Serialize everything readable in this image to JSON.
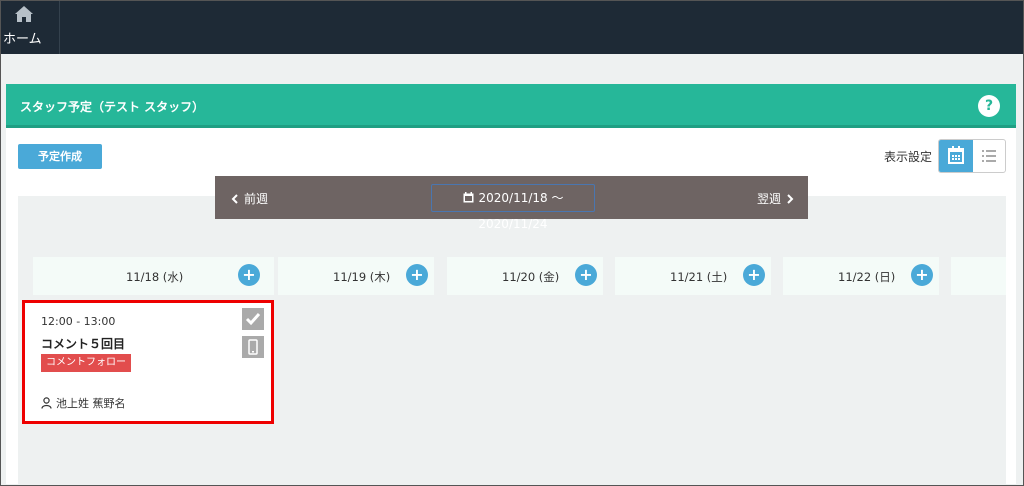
{
  "nav": {
    "home_label": "ホーム"
  },
  "panel": {
    "title": "スタッフ予定（テスト スタッフ）",
    "help": "?"
  },
  "toolbar": {
    "create_label": "予定作成",
    "display_settings_label": "表示設定"
  },
  "week_nav": {
    "prev_label": "前週",
    "next_label": "翌週",
    "range": "2020/11/18 ～ 2020/11/24"
  },
  "days": [
    {
      "label": "11/18 (水)"
    },
    {
      "label": "11/19 (木)"
    },
    {
      "label": "11/20 (金)"
    },
    {
      "label": "11/21 (土)"
    },
    {
      "label": "11/22 (日)"
    }
  ],
  "event": {
    "time": "12:00 - 13:00",
    "title": "コメント５回目",
    "tag": "コメントフォロー",
    "user": "池上姓 蕉野名"
  },
  "colors": {
    "header": "#1e2a36",
    "accent": "#26b799",
    "button": "#4aa9d8",
    "tag": "#e24d4d",
    "highlight": "#ee0000"
  }
}
